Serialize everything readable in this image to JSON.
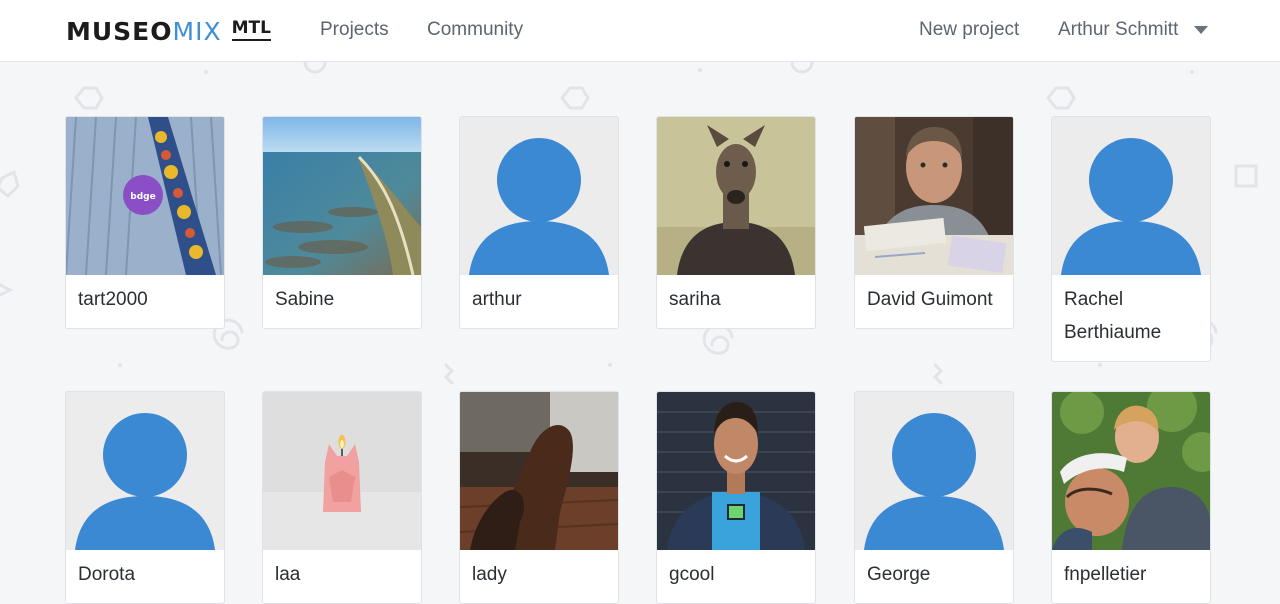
{
  "header": {
    "logo_main": "MUSEO",
    "logo_accent": "MIX",
    "logo_city": "MTL",
    "nav": {
      "projects": "Projects",
      "community": "Community"
    },
    "new_project": "New project",
    "user_name": "Arthur Schmitt"
  },
  "members": [
    {
      "name": "tart2000",
      "photo": "badge-tie-photo"
    },
    {
      "name": "Sabine",
      "photo": "coastline-aerial-photo"
    },
    {
      "name": "arthur",
      "photo": "default-avatar"
    },
    {
      "name": "sariha",
      "photo": "deer-head-photo"
    },
    {
      "name": "David Guimont",
      "photo": "man-at-desk-photo"
    },
    {
      "name": "Rachel Berthiaume",
      "photo": "default-avatar"
    },
    {
      "name": "Dorota",
      "photo": "default-avatar"
    },
    {
      "name": "laa",
      "photo": "pink-cat-candle-photo"
    },
    {
      "name": "lady",
      "photo": "brown-shoes-photo"
    },
    {
      "name": "gcool",
      "photo": "smiling-man-brick-wall-photo"
    },
    {
      "name": "George",
      "photo": "default-avatar"
    },
    {
      "name": "fnpelletier",
      "photo": "father-child-hug-photo"
    }
  ],
  "colors": {
    "accent": "#3d8fd6",
    "avatar_blue": "#3b88d3",
    "background": "#f5f6f8"
  }
}
